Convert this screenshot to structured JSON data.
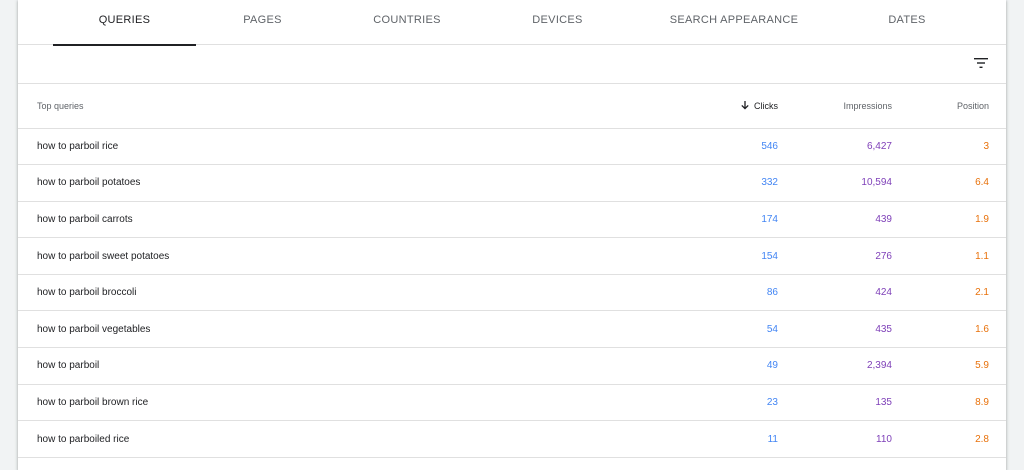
{
  "tabs": [
    {
      "label": "QUERIES",
      "active": true
    },
    {
      "label": "PAGES",
      "active": false
    },
    {
      "label": "COUNTRIES",
      "active": false
    },
    {
      "label": "DEVICES",
      "active": false
    },
    {
      "label": "SEARCH APPEARANCE",
      "active": false
    },
    {
      "label": "DATES",
      "active": false
    }
  ],
  "table": {
    "headers": {
      "query": "Top queries",
      "clicks": "Clicks",
      "impressions": "Impressions",
      "position": "Position"
    },
    "sort_icon": "arrow-down-icon",
    "rows": [
      {
        "query": "how to parboil rice",
        "clicks": "546",
        "impressions": "6,427",
        "position": "3"
      },
      {
        "query": "how to parboil potatoes",
        "clicks": "332",
        "impressions": "10,594",
        "position": "6.4"
      },
      {
        "query": "how to parboil carrots",
        "clicks": "174",
        "impressions": "439",
        "position": "1.9"
      },
      {
        "query": "how to parboil sweet potatoes",
        "clicks": "154",
        "impressions": "276",
        "position": "1.1"
      },
      {
        "query": "how to parboil broccoli",
        "clicks": "86",
        "impressions": "424",
        "position": "2.1"
      },
      {
        "query": "how to parboil vegetables",
        "clicks": "54",
        "impressions": "435",
        "position": "1.6"
      },
      {
        "query": "how to parboil",
        "clicks": "49",
        "impressions": "2,394",
        "position": "5.9"
      },
      {
        "query": "how to parboil brown rice",
        "clicks": "23",
        "impressions": "135",
        "position": "8.9"
      },
      {
        "query": "how to parboiled rice",
        "clicks": "11",
        "impressions": "110",
        "position": "2.8"
      }
    ]
  },
  "colors": {
    "clicks": "#4285f4",
    "impressions": "#7e3fb8",
    "position": "#e8710a"
  },
  "icons": {
    "filter": "filter-icon"
  }
}
